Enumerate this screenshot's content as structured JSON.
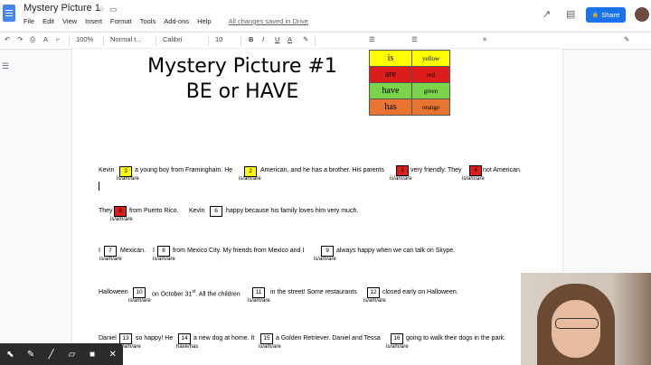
{
  "app": {
    "title": "Mystery Picture 1",
    "menu": [
      "File",
      "Edit",
      "View",
      "Insert",
      "Format",
      "Tools",
      "Add-ons",
      "Help"
    ],
    "saved_status": "All changes saved in Drive",
    "share_label": "Share"
  },
  "toolbar": {
    "zoom": "100%",
    "style": "Normal t...",
    "font": "Calibri",
    "size": "10",
    "bold": "B",
    "italic": "I",
    "underline": "U",
    "text_color": "A"
  },
  "doc": {
    "title_line1": "Mystery Picture #1",
    "title_line2": "BE or HAVE",
    "legend": [
      {
        "verb": "is",
        "color": "yellow",
        "hex": "#ffff00"
      },
      {
        "verb": "are",
        "color": "red",
        "hex": "#dd1c1c"
      },
      {
        "verb": "have",
        "color": "green",
        "hex": "#7bd34a"
      },
      {
        "verb": "has",
        "color": "orange",
        "hex": "#e8752f"
      }
    ],
    "hint_be": "is/am/are",
    "hint_have": "have/has",
    "line1": {
      "a": "Kevin",
      "b1": "3",
      "b": "a young boy from Framingham.  He",
      "b2": "2",
      "c": "American, and he has a brother.  His parents",
      "b3": "1",
      "d": "very friendly.  They",
      "b4": "4",
      "e": "not American."
    },
    "line2": {
      "a": "They",
      "b1": "5",
      "b": "from Puerto Rico.",
      "c": "Kevin",
      "b2": "6",
      "d": "happy because his family loves him very much."
    },
    "line3": {
      "a": "I",
      "b1": "7",
      "b": "Mexican.",
      "c": "I",
      "b2": "8",
      "d": "from Mexico City.  My friends from Mexico and I",
      "b3": "9",
      "e": "always happy when we can talk on Skype."
    },
    "line4": {
      "a": "Halloween",
      "b1": "10",
      "b": "on October 31",
      "sup": "st",
      "c": ".  All the children",
      "b2": "11",
      "d": "in the street!  Some restaurants",
      "b3": "12",
      "e": "closed early on Halloween."
    },
    "line5": {
      "a": "Daniel",
      "b1": "13",
      "b": "so happy! He",
      "b2": "14",
      "c": "a new dog at home. It",
      "b3": "15",
      "d": "a Golden Retriever.   Daniel and Tessa",
      "b4": "16",
      "e": "going to walk their dogs in the park."
    }
  },
  "icons": {
    "star": "☆",
    "folder": "▭",
    "trend": "↗",
    "comment": "▤",
    "lock": "🔒",
    "undo": "↶",
    "redo": "↷",
    "print": "⎙",
    "spell": "A",
    "paint": "⌐",
    "pencil": "✎",
    "clear": "⨯",
    "outline": "☰",
    "annot_pointer": "⬉",
    "annot_pen": "✎",
    "annot_marker": "╱",
    "annot_eraser": "▱",
    "annot_camera": "■",
    "annot_close": "✕"
  }
}
